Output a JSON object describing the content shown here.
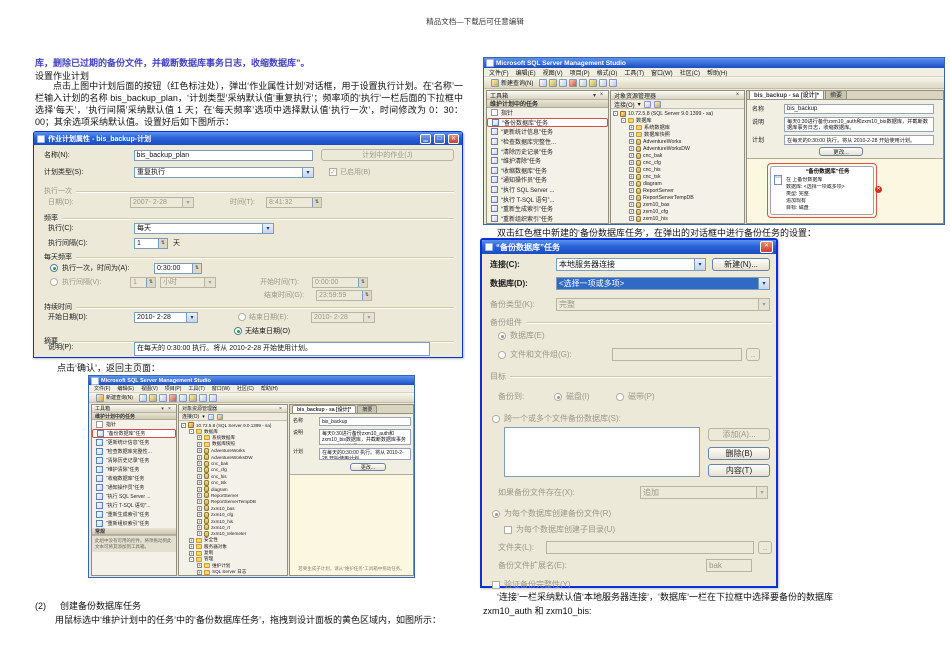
{
  "colors": {
    "annotation_red": "#d05050",
    "xp_title_blue": "#2a62d8",
    "design_surface_yellow": "#fbf7e1",
    "doc_highlight": "#4343bf",
    "selected_combo_blue": "#316ac5"
  },
  "header": {
    "text": "精品文档—下载后可任意编辑"
  },
  "doc": {
    "line1": "库，删除已过期的备份文件，并截断数据库事务日志，收缩数据库”。",
    "heading": "设置作业计划",
    "para1": "点击上图中计划后面的按钮（红色标注处），弹出‘作业属性计划’对话框，用于设置执行计划。在‘名称’一栏输入计划的名称 bis_backup_plan，‘计划类型’采纳默认值‘重复执行’；频率项的‘执行’一栏后面的下拉框中选择‘每天’，‘执行间隔’采纳默认值 1 天；在‘每天频率’选项中选择默认值‘执行一次’，时间修改为 0：30：00；其余选项采纳默认值。设置好后如下图所示：",
    "confirm_text": "点击‘确认’，返回主页面：",
    "step2_label": "(2)",
    "step2_title": "创建备份数据库任务",
    "step2_text": "用鼠标选中‘维护计划中的任务’中的‘备份数据库任务’，拖拽到设计面板的黄色区域内，如图所示：",
    "dblclick_text": "双击红色框中新建的‘备份数据库任务’，在弹出的对话框中进行备份任务的设置：",
    "footer_line1": "‘连接’一栏采纳默认值‘本地服务器连接’，‘数据库’一栏在下拉框中选择要备份的数据库",
    "footer_line2": "zxm10_auth 和 zxm10_bis:"
  },
  "schedule_dialog": {
    "title": "作业计划属性 - bis_backup-计划",
    "name_label": "名称(N):",
    "name_value": "bis_backup_plan",
    "jobs_button": "计划中的作业(J)",
    "type_label": "计划类型(S):",
    "type_value": "重复执行",
    "enabled_label": "已启用(B)",
    "once_section": "执行一次",
    "date_label": "日期(D):",
    "date_value": "2007- 2-28",
    "time_label": "时间(T):",
    "time_value": "8:41:32",
    "freq_section": "频率",
    "exec_label": "执行(C):",
    "exec_value": "每天",
    "interval_label": "执行间隔(C):",
    "interval_value": "1",
    "interval_unit": "天",
    "daily_section": "每天频率",
    "once_at_label": "执行一次，时间为(A):",
    "once_at_value": "0:30:00",
    "every_label": "执行间隔(V):",
    "every_value": "1",
    "every_unit": "小时",
    "start_time_label": "开始时间(T):",
    "start_time_value": "0:00:00",
    "end_time_label": "结束时间(G):",
    "end_time_value": "23:59:59",
    "duration_section": "持续时间",
    "start_date_label": "开始日期(D):",
    "start_date_value": "2010- 2-28",
    "end_date_label": "结束日期(E):",
    "end_date_value": "2010- 2-28",
    "no_end_label": "无结束日期(O)",
    "summary_section": "摘要",
    "desc_label": "说明(P):",
    "desc_value": "在每天的 0:30:00 执行。将从 2010-2-28 开始使用计划。"
  },
  "ssms": {
    "title": "Microsoft SQL Server Management Studio",
    "menus2": [
      "文件(F)",
      "编辑(E)",
      "视图(V)",
      "项目(P)",
      "工具(T)",
      "窗口(W)",
      "社区(C)",
      "帮助(H)"
    ],
    "menus3": [
      "文件(F)",
      "编辑(E)",
      "视图(V)",
      "项目(P)",
      "格式(O)",
      "工具(T)",
      "窗口(W)",
      "社区(C)",
      "帮助(H)"
    ],
    "new_query": "新建查询(N)",
    "toolbox_header": "工具箱",
    "toolbox_group": "维护计划中的任务",
    "pointer_item": "指针",
    "toolbox_items": [
      {
        "label": "“备份数据库”任务",
        "cls": "hl"
      },
      {
        "label": "“更新统计信息”任务"
      },
      {
        "label": "“检查数据库完整性..."
      },
      {
        "label": "“清除历史记录”任务"
      },
      {
        "label": "“维护清除”任务"
      },
      {
        "label": "“收缩数据库”任务"
      },
      {
        "label": "“通知操作员”任务"
      },
      {
        "label": "“执行 SQL Server ..."
      },
      {
        "label": "“执行 T-SQL 语句”..."
      },
      {
        "label": "“重新生成索引”任务"
      },
      {
        "label": "“重新组织索引”任务"
      }
    ],
    "toolbox_general_group": "常规",
    "toolbox_general_hint": "此组中没有可用的控件。将项拖动到此文本可将其添加到工具箱。",
    "objexp_header": "对象资源管理器",
    "objexp_connect": "连接(O)",
    "tree": [
      {
        "label": "10.72.5.8 (SQL Server 9.0.1399 - sa)",
        "box": "-",
        "cls": "lvl0 srv"
      },
      {
        "label": "数据库",
        "box": "-",
        "cls": "lvl1 folder"
      },
      {
        "label": "系统数据库",
        "box": "+",
        "cls": "lvl2 folder"
      },
      {
        "label": "数据库快照",
        "box": "+",
        "cls": "lvl2 folder"
      },
      {
        "label": "AdventureWorks",
        "box": "+",
        "cls": "lvl2 db"
      },
      {
        "label": "AdventureWorksDW",
        "box": "+",
        "cls": "lvl2 db"
      },
      {
        "label": "cnc_bak",
        "box": "+",
        "cls": "lvl2 db"
      },
      {
        "label": "cnc_cfg",
        "box": "+",
        "cls": "lvl2 db"
      },
      {
        "label": "cnc_his",
        "box": "+",
        "cls": "lvl2 db"
      },
      {
        "label": "cnc_tsk",
        "box": "+",
        "cls": "lvl2 db"
      },
      {
        "label": "diagram",
        "box": "+",
        "cls": "lvl2 db"
      },
      {
        "label": "ReportServer",
        "box": "+",
        "cls": "lvl2 db"
      },
      {
        "label": "ReportServerTempDB",
        "box": "+",
        "cls": "lvl2 db"
      },
      {
        "label": "zxm10_bas",
        "box": "+",
        "cls": "lvl2 db"
      },
      {
        "label": "zxm10_cfg",
        "box": "+",
        "cls": "lvl2 db"
      },
      {
        "label": "zxm10_his",
        "box": "+",
        "cls": "lvl2 db"
      },
      {
        "label": "zxm10_rt",
        "box": "+",
        "cls": "lvl2 db"
      },
      {
        "label": "zxm10_telemeter",
        "box": "+",
        "cls": "lvl2 db"
      },
      {
        "label": "安全性",
        "box": "+",
        "cls": "lvl1 folder"
      },
      {
        "label": "服务器对象",
        "box": "+",
        "cls": "lvl1 folder"
      },
      {
        "label": "复制",
        "box": "+",
        "cls": "lvl1 folder"
      },
      {
        "label": "管理",
        "box": "-",
        "cls": "lvl1 folder"
      },
      {
        "label": "维护计划",
        "box": "+",
        "cls": "lvl2 folder"
      },
      {
        "label": "SQL Server 日志",
        "box": "+",
        "cls": "lvl2 folder"
      }
    ],
    "tab_label": "bis_backup - sa [设计]*",
    "tab2_label": "摘要",
    "fields": {
      "name_label": "名称",
      "name_value": "bis_backup",
      "desc_label": "说明",
      "desc_value": "每天0:30进行备份zxm10_auth和zxm10_bis数据库，并截断数据库事务日志，收缩数据库。",
      "plan_label": "计划",
      "plan_value": "在每天的0:30:00 执行。将从 2010-2-28 开始使用计划。",
      "change_button": "更改..."
    },
    "design_hint": "若要生成子计划，请从“维护任务”工具箱中拖动任务。"
  },
  "task_box": {
    "title": "“备份数据库”任务",
    "line1": "在 上备份数据库",
    "line2": "数据库: <选择一项或多项>",
    "line3": "类型: 完整",
    "line4": "追加现有",
    "line5": "目标: 磁盘"
  },
  "backup_dialog": {
    "title": "“备份数据库”任务",
    "conn_label": "连接(C):",
    "conn_value": "本地服务器连接",
    "new_button": "新建(N)...",
    "db_label": "数据库(D):",
    "db_value": "<选择一项或多项>",
    "type_label": "备份类型(K):",
    "type_value": "完整",
    "component_section": "备份组件",
    "radio_db": "数据库(E)",
    "radio_files": "文件和文件组(G):",
    "dest_section": "目标",
    "backup_to_label": "备份到:",
    "disk_label": "磁盘(I)",
    "tape_label": "磁带(P)",
    "across_label": "跨一个或多个文件备份数据库(S):",
    "add_button": "添加(A)...",
    "remove_button": "删除(B)",
    "contents_button": "内容(T)",
    "exists_label": "如果备份文件存在(X):",
    "exists_value": "追加",
    "create_file_label": "为每个数据库创建备份文件(R)",
    "subdir_label": "为每个数据库创建子目录(U)",
    "folder_label": "文件夹(L):",
    "ext_label": "备份文件扩展名(E):",
    "ext_value": "bak",
    "verify_label": "验证备份完整性(Y)"
  }
}
